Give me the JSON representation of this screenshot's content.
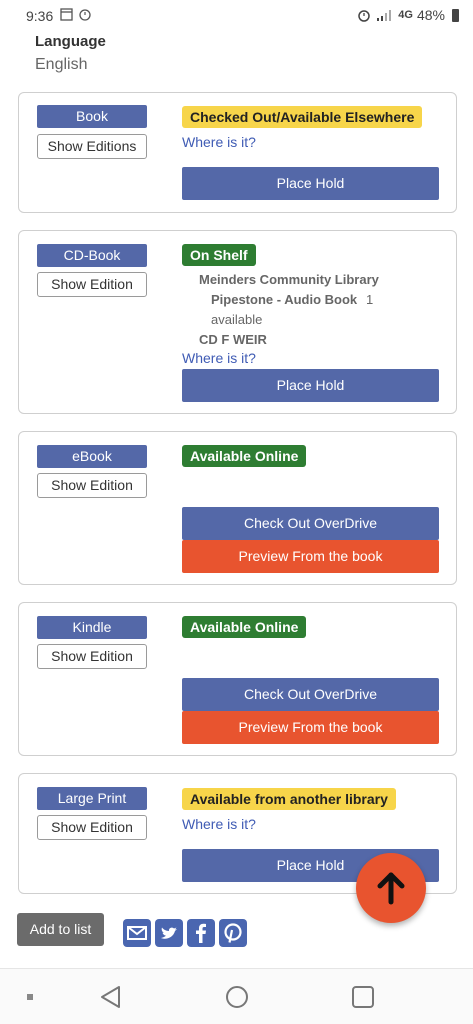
{
  "status_bar": {
    "time": "9:36",
    "network": "4G",
    "battery": "48%"
  },
  "language": {
    "label": "Language",
    "value": "English"
  },
  "formats": [
    {
      "format": "Book",
      "edition_label": "Show Editions",
      "status": "Checked Out/Available Elsewhere",
      "where_link": "Where is it?",
      "primary_action": "Place Hold"
    },
    {
      "format": "CD-Book",
      "edition_label": "Show Edition",
      "status": "On Shelf",
      "location_library": "Meinders Community Library",
      "location_collection": "Pipestone - Audio Book",
      "location_count": "1",
      "location_available": "available",
      "call_number": "CD F WEIR",
      "where_link": "Where is it?",
      "primary_action": "Place Hold"
    },
    {
      "format": "eBook",
      "edition_label": "Show Edition",
      "status": "Available Online",
      "primary_action": "Check Out OverDrive",
      "secondary_action": "Preview From the book"
    },
    {
      "format": "Kindle",
      "edition_label": "Show Edition",
      "status": "Available Online",
      "primary_action": "Check Out OverDrive",
      "secondary_action": "Preview From the book"
    },
    {
      "format": "Large Print",
      "edition_label": "Show Edition",
      "status": "Available from another library",
      "where_link": "Where is it?",
      "primary_action": "Place Hold"
    }
  ],
  "footer": {
    "add_to_list": "Add to list"
  },
  "share_icons": [
    "email-icon",
    "twitter-icon",
    "facebook-icon",
    "pinterest-icon"
  ],
  "colors": {
    "primary": "#5468a8",
    "accent": "#e8542f",
    "on_shelf": "#2e7d32",
    "warning": "#f7d54a",
    "link": "#3f5bb4"
  }
}
